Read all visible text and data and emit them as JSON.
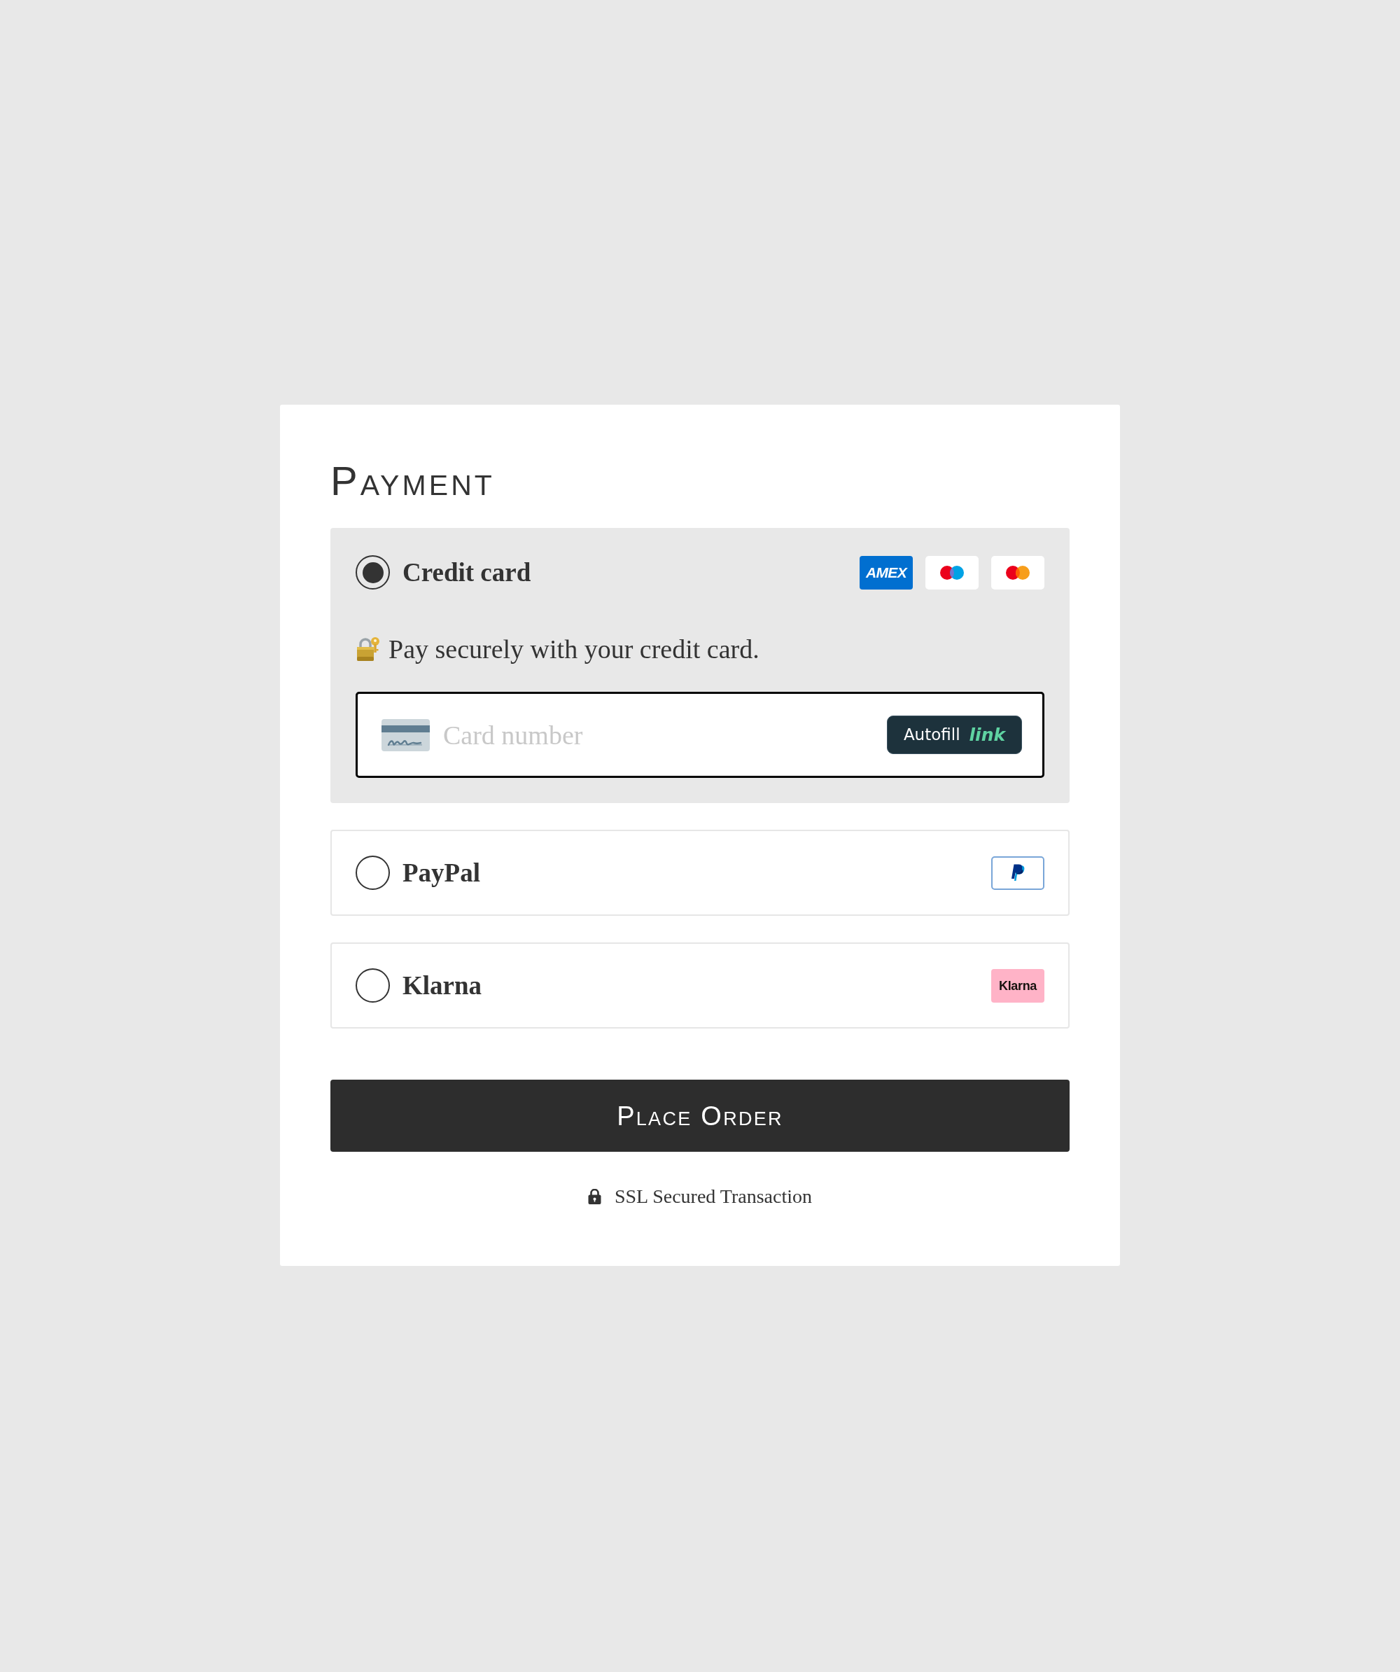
{
  "title": "Payment",
  "methods": [
    {
      "label": "Credit card",
      "selected": true,
      "brands": [
        {
          "kind": "amex",
          "label": "AMEX"
        },
        {
          "kind": "maestro"
        },
        {
          "kind": "mastercard"
        }
      ],
      "description": "Pay securely with your credit card.",
      "card_field": {
        "placeholder": "Card number",
        "autofill": {
          "label": "Autofill",
          "brand": "link"
        }
      }
    },
    {
      "label": "PayPal",
      "selected": false,
      "brands": [
        {
          "kind": "paypal"
        }
      ]
    },
    {
      "label": "Klarna",
      "selected": false,
      "brands": [
        {
          "kind": "klarna",
          "label": "Klarna"
        }
      ]
    }
  ],
  "submit_button": "Place Order",
  "security_note": "SSL Secured Transaction"
}
